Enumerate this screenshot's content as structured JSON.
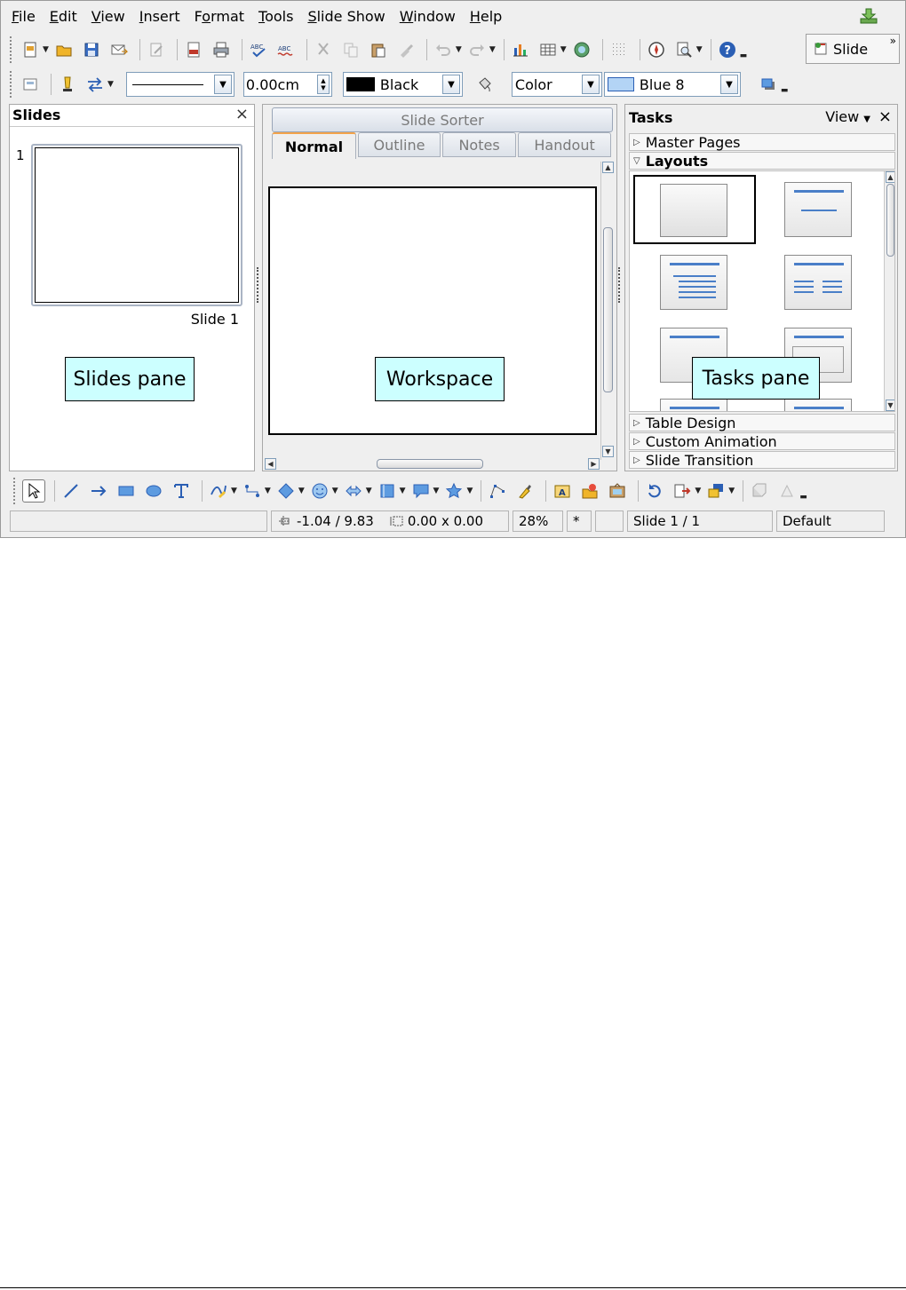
{
  "menu": {
    "file": "File",
    "edit": "Edit",
    "view": "View",
    "insert": "Insert",
    "format": "Format",
    "tools": "Tools",
    "slide_show": "Slide Show",
    "window": "Window",
    "help": "Help"
  },
  "standard_toolbar": {
    "slide_button_label": "Slide",
    "icons": [
      "new-icon",
      "open-icon",
      "save-icon",
      "email-icon",
      "edit-file-icon",
      "export-pdf-icon",
      "print-icon",
      "spellcheck-icon",
      "autospellcheck-icon",
      "cut-icon",
      "copy-icon",
      "paste-icon",
      "format-paintbrush-icon",
      "undo-icon",
      "redo-icon",
      "chart-icon",
      "table-icon",
      "image-gallery-icon",
      "grid-icon",
      "navigator-icon",
      "zoom-icon",
      "help-icon"
    ]
  },
  "line_fill_toolbar": {
    "line_style_value": "",
    "line_width_value": "0.00cm",
    "line_color_value": "Black",
    "line_color_swatch": "#000000",
    "area_style_value": "Color",
    "area_fill_value": "Blue 8",
    "area_fill_swatch": "#b3d4f5"
  },
  "slides_pane": {
    "title": "Slides",
    "close": "×",
    "slides": [
      {
        "number": "1",
        "label": "Slide 1"
      }
    ],
    "callout": "Slides pane"
  },
  "workspace": {
    "sorter_tab": "Slide Sorter",
    "tabs": [
      "Normal",
      "Outline",
      "Notes",
      "Handout"
    ],
    "active_tab": "Normal",
    "callout": "Workspace"
  },
  "tasks_pane": {
    "title": "Tasks",
    "view_label": "View",
    "close": "×",
    "sections": {
      "master_pages": "Master Pages",
      "layouts": "Layouts",
      "table_design": "Table Design",
      "custom_animation": "Custom Animation",
      "slide_transition": "Slide Transition"
    },
    "callout": "Tasks pane"
  },
  "drawing_toolbar": {
    "icons": [
      "select-icon",
      "line-icon",
      "arrow-icon",
      "rectangle-icon",
      "ellipse-icon",
      "text-icon",
      "curve-icon",
      "connector-icon",
      "basic-shapes-icon",
      "symbol-shapes-icon",
      "block-arrows-icon",
      "flowchart-icon",
      "callouts-icon",
      "stars-icon",
      "points-icon",
      "glue-points-icon",
      "fontwork-icon",
      "from-file-icon",
      "gallery-icon",
      "rotate-icon",
      "alignment-icon",
      "arrange-icon",
      "extrusion-icon",
      "3d-effects-icon"
    ]
  },
  "statusbar": {
    "message": "",
    "position": "-1.04 / 9.83",
    "size": "0.00 x 0.00",
    "zoom": "28%",
    "modified": "*",
    "slide": "Slide 1 / 1",
    "master": "Default"
  },
  "colors": {
    "callout_bg": "#ccffff",
    "accent_orange": "#f3a34a",
    "icon_blue": "#2b5fb4"
  }
}
